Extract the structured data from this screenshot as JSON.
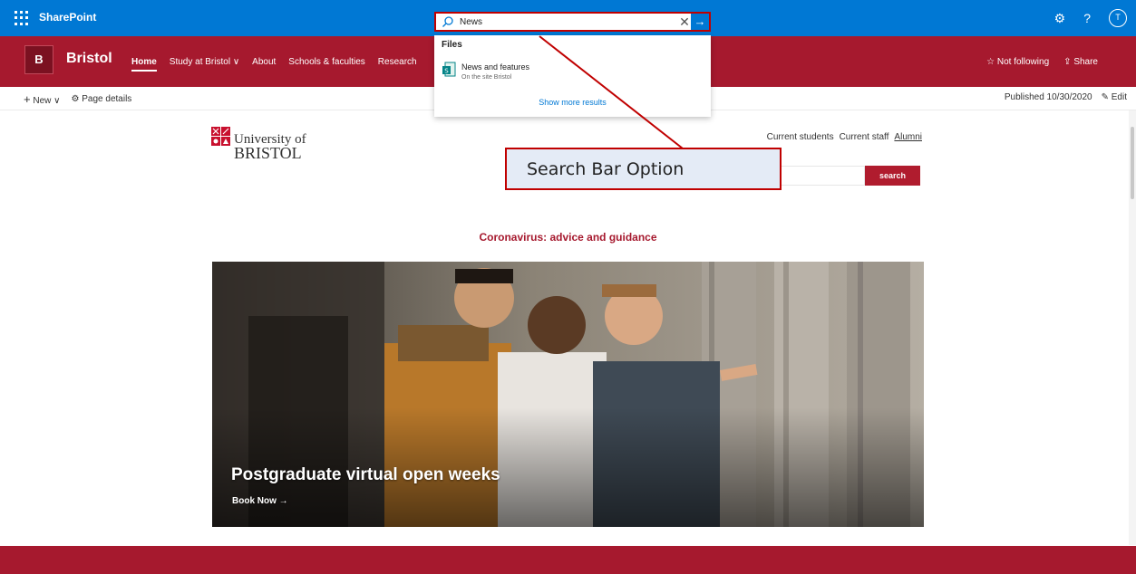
{
  "suitebar": {
    "app_name": "SharePoint",
    "search_value": "News",
    "settings_icon": "gear-icon",
    "help_label": "?",
    "avatar_initial": "T"
  },
  "search_dropdown": {
    "heading": "Files",
    "result": {
      "name": "News and features",
      "location": "On the site Bristol"
    },
    "more_link": "Show more results"
  },
  "site_header": {
    "logo_letter": "B",
    "site_name": "Bristol",
    "nav": [
      {
        "label": "Home"
      },
      {
        "label": "Study at Bristol ∨"
      },
      {
        "label": "About"
      },
      {
        "label": "Schools & faculties"
      },
      {
        "label": "Research"
      }
    ],
    "follow_label": "Not following",
    "share_label": "Share"
  },
  "commandbar": {
    "new_label": "New",
    "page_details_label": "Page details",
    "published_label": "Published 10/30/2020",
    "edit_label": "Edit"
  },
  "page": {
    "logo_line1": "University of",
    "logo_line2": "BRISTOL",
    "links": [
      "Current students",
      "Current staff",
      "Alumni"
    ],
    "search_button": "search",
    "alert": "Coronavirus: advice and guidance",
    "hero_title": "Postgraduate virtual open weeks",
    "hero_cta": "Book Now →"
  },
  "annotation": {
    "callout_text": "Search Bar Option"
  },
  "colors": {
    "suitebar": "#0078d4",
    "brand_red": "#a6192e",
    "annotation_red": "#c00000"
  }
}
